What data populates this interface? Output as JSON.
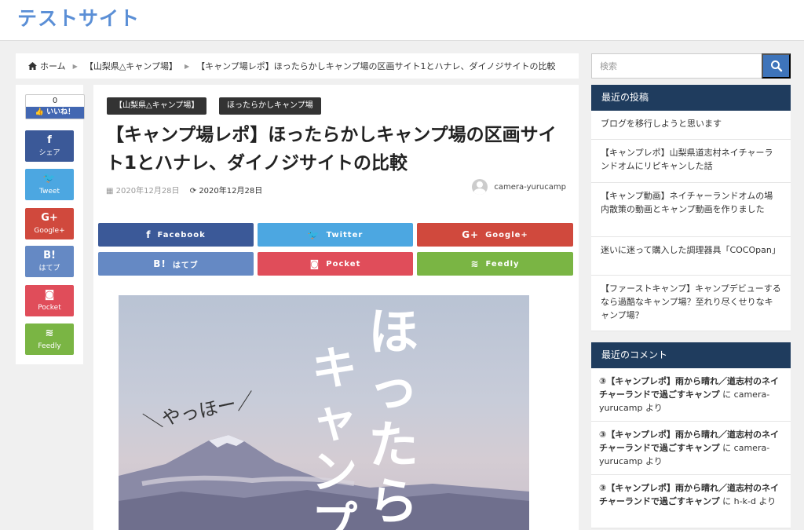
{
  "site": {
    "title": "テストサイト"
  },
  "breadcrumb": {
    "home": "ホーム",
    "category": "【山梨県△キャンプ場】",
    "current": "【キャンプ場レポ】ほったらかしキャンプ場の区画サイト1とハナレ、ダイノジサイトの比較"
  },
  "share_rail": {
    "like_count": "0",
    "like_label": "いいね！",
    "buttons": [
      {
        "icon": "f",
        "label": "シェア",
        "color": "#3b5998"
      },
      {
        "icon": "🐦",
        "label": "Tweet",
        "color": "#4ca7e1"
      },
      {
        "icon": "G+",
        "label": "Google+",
        "color": "#d0493d"
      },
      {
        "icon": "B!",
        "label": "はてブ",
        "color": "#6589c4"
      },
      {
        "icon": "◙",
        "label": "Pocket",
        "color": "#e04d5a"
      },
      {
        "icon": "≋",
        "label": "Feedly",
        "color": "#7ab544"
      }
    ]
  },
  "article": {
    "categories": [
      "【山梨県△キャンプ場】",
      "ほったらかしキャンプ場"
    ],
    "title": "【キャンプ場レポ】ほったらかしキャンプ場の区画サイト1とハナレ、ダイノジサイトの比較",
    "published": "2020年12月28日",
    "updated": "2020年12月28日",
    "author": "camera-yurucamp",
    "share_buttons": [
      {
        "icon": "f",
        "label": "Facebook",
        "color": "#3b5998"
      },
      {
        "icon": "🐦",
        "label": "Twitter",
        "color": "#4ca7e1"
      },
      {
        "icon": "G+",
        "label": "Google+",
        "color": "#d0493d"
      },
      {
        "icon": "B!",
        "label": "はてブ",
        "color": "#6589c4"
      },
      {
        "icon": "◙",
        "label": "Pocket",
        "color": "#e04d5a"
      },
      {
        "icon": "≋",
        "label": "Feedly",
        "color": "#7ab544"
      }
    ],
    "hero": {
      "handwriting": "＼やっほー／",
      "vertical_text_1": "ほったら",
      "vertical_text_2": "キャンプ"
    }
  },
  "sidebar": {
    "search_placeholder": "検索",
    "recent_posts_title": "最近の投稿",
    "recent_posts": [
      "ブログを移行しようと思います",
      "【キャンプレポ】山梨県道志村ネイチャーランドオムにリピキャンした話",
      "【キャンプ動画】ネイチャーランドオムの場内散策の動画とキャンプ動画を作りました",
      "迷いに迷って購入した調理器具「COCOpan」",
      "【ファーストキャンプ】キャンプデビューするなら過酷なキャンプ場？至れり尽くせりなキャンプ場？"
    ],
    "recent_comments_title": "最近のコメント",
    "recent_comments": [
      {
        "post": "③【キャンプレポ】雨から晴れ／道志村のネイチャーランドで過ごすキャンプ",
        "joiner": " に ",
        "author": "camera-yurucamp",
        "suffix": " より"
      },
      {
        "post": "③【キャンプレポ】雨から晴れ／道志村のネイチャーランドで過ごすキャンプ",
        "joiner": " に ",
        "author": "camera-yurucamp",
        "suffix": " より"
      },
      {
        "post": "③【キャンプレポ】雨から晴れ／道志村のネイチャーランドで過ごすキャンプ",
        "joiner": " に ",
        "author": "h-k-d",
        "suffix": " より"
      }
    ]
  },
  "colors": {
    "accent": "#5b8fd6",
    "widget_header": "#1f3c5e",
    "search_button": "#3e74ba"
  }
}
